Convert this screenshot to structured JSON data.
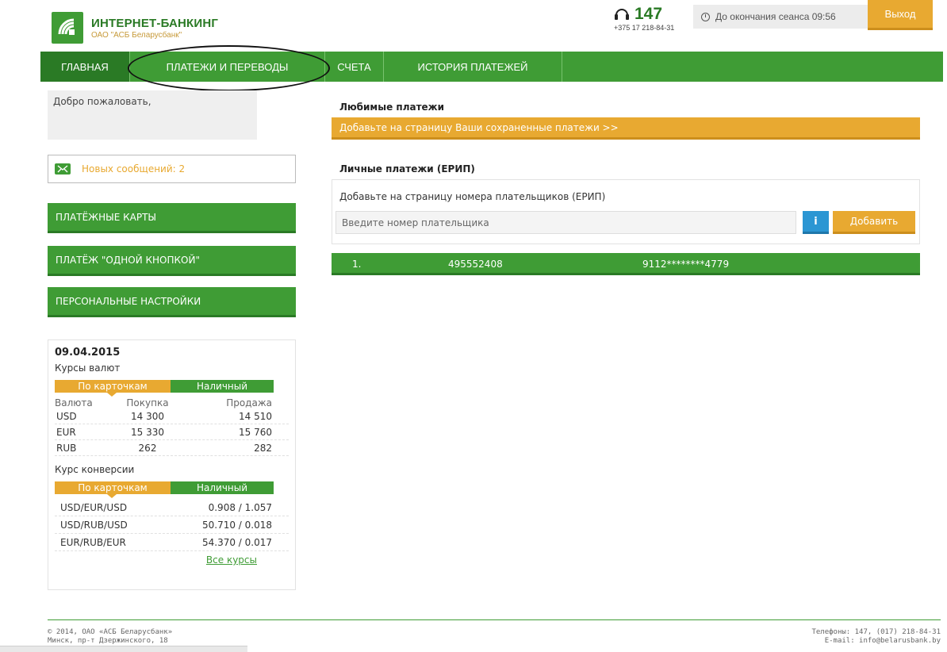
{
  "header": {
    "logo_title": "ИНТЕРНЕТ-БАНКИНГ",
    "logo_subtitle": "ОАО \"АСБ Беларусбанк\"",
    "hotline_number": "147",
    "hotline_phone": "+375 17 218-84-31",
    "session_text": "До окончания сеанса 09:56",
    "logout_label": "Выход"
  },
  "nav": {
    "items": [
      {
        "label": "ГЛАВНАЯ"
      },
      {
        "label": "ПЛАТЕЖИ И ПЕРЕВОДЫ"
      },
      {
        "label": "СЧЕТА"
      },
      {
        "label": "ИСТОРИЯ ПЛАТЕЖЕЙ"
      }
    ]
  },
  "sidebar": {
    "welcome": "Добро пожаловать,",
    "messages": "Новых сообщений: 2",
    "buttons": [
      {
        "label": "ПЛАТЁЖНЫЕ КАРТЫ"
      },
      {
        "label": "ПЛАТЁЖ \"ОДНОЙ КНОПКОЙ\""
      },
      {
        "label": "ПЕРСОНАЛЬНЫЕ НАСТРОЙКИ"
      }
    ]
  },
  "rates": {
    "date": "09.04.2015",
    "currency_caption": "Курсы валют",
    "tab_cards": "По карточкам",
    "tab_cash": "Наличный",
    "headers": [
      "Валюта",
      "Покупка",
      "Продажа"
    ],
    "rows": [
      {
        "currency": "USD",
        "buy": "14 300",
        "sell": "14 510"
      },
      {
        "currency": "EUR",
        "buy": "15 330",
        "sell": "15 760"
      },
      {
        "currency": "RUB",
        "buy": "262",
        "sell": "282"
      }
    ],
    "conversion_caption": "Курс конверсии",
    "conversion": [
      {
        "pair": "USD/EUR/USD",
        "value": "0.908 / 1.057"
      },
      {
        "pair": "USD/RUB/USD",
        "value": "50.710 / 0.018"
      },
      {
        "pair": "EUR/RUB/EUR",
        "value": "54.370 / 0.017"
      }
    ],
    "all_rates_link": "Все курсы"
  },
  "main": {
    "favorites_title": "Любимые платежи",
    "favorites_bar": "Добавьте на страницу Ваши сохраненные платежи >>",
    "erip_title": "Личные платежи (ЕРИП)",
    "erip_hint": "Добавьте на страницу номера плательщиков (ЕРИП)",
    "erip_placeholder": "Введите номер плательщика",
    "info_label": "i",
    "add_label": "Добавить",
    "payers": [
      {
        "n": "1.",
        "number": "495552408",
        "card": "9112********4779"
      }
    ]
  },
  "footer": {
    "copyright": "© 2014, ОАО «АСБ Беларусбанк»",
    "address": "Минск, пр-т Дзержинского, 18",
    "phones": "Телефоны: 147, (017) 218-84-31",
    "email": "E-mail: info@belarusbank.by"
  },
  "colors": {
    "green": "#3f9c35",
    "dark_green": "#2a7a25",
    "orange": "#e8a931",
    "blue": "#2b96d3"
  }
}
